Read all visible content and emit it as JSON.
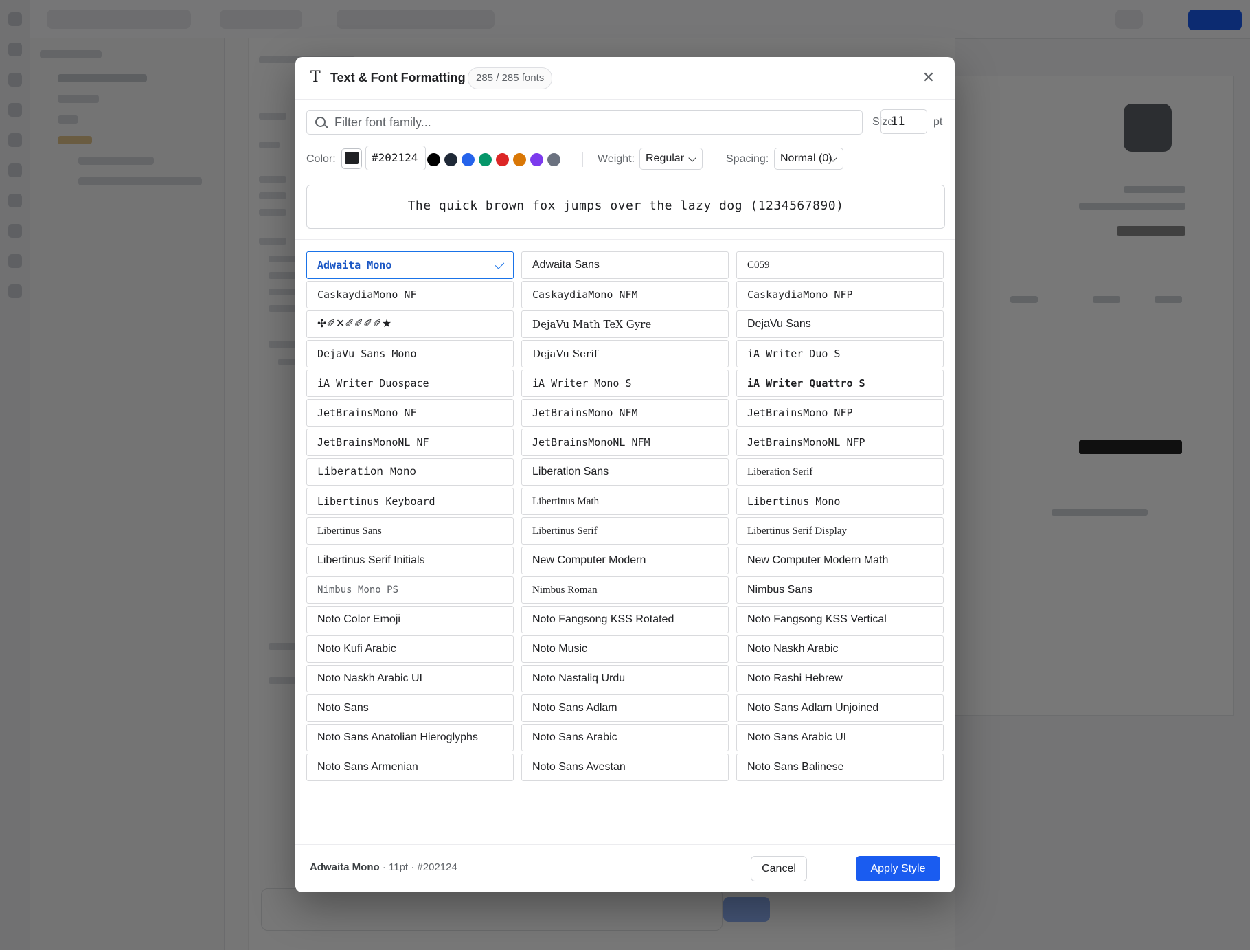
{
  "modal": {
    "title": "Text & Font Formatting",
    "title_icon": "T",
    "font_count": "285 / 285 fonts",
    "close_glyph": "✕",
    "search_placeholder": "Filter font family...",
    "size_label": "Size:",
    "size_value": "11",
    "size_unit": "pt",
    "color_label": "Color:",
    "color_hex": "#202124",
    "preset_colors": [
      "#000000",
      "#1f2937",
      "#2563eb",
      "#059669",
      "#dc2626",
      "#d97706",
      "#7c3aed",
      "#6b7280"
    ],
    "weight_label": "Weight:",
    "weight_value": "Regular",
    "spacing_label": "Spacing:",
    "spacing_value": "Normal (0)",
    "sample_text": "The quick brown fox jumps over the lazy dog (1234567890)",
    "fonts": [
      "Adwaita Mono",
      "Adwaita Sans",
      "C059",
      "CaskaydiaMono NF",
      "CaskaydiaMono NFM",
      "CaskaydiaMono NFP",
      "✣✐✕✐✐✐✐★",
      "DejaVu Math TeX Gyre",
      "DejaVu Sans",
      "DejaVu Sans Mono",
      "DejaVu Serif",
      "iA Writer Duo S",
      "iA Writer Duospace",
      "iA Writer Mono S",
      "iA Writer Quattro S",
      "JetBrainsMono NF",
      "JetBrainsMono NFM",
      "JetBrainsMono NFP",
      "JetBrainsMonoNL NF",
      "JetBrainsMonoNL NFM",
      "JetBrainsMonoNL NFP",
      "Liberation Mono",
      "Liberation Sans",
      "Liberation Serif",
      "Libertinus Keyboard",
      "Libertinus Math",
      "Libertinus Mono",
      "Libertinus Sans",
      "Libertinus Serif",
      "Libertinus Serif Display",
      "Libertinus Serif Initials",
      "New Computer Modern",
      "New Computer Modern Math",
      "Nimbus Mono PS",
      "Nimbus Roman",
      "Nimbus Sans",
      "Noto    Color    Emoji",
      "Noto  Fangsong  KSS  Rotated",
      "Noto  Fangsong  KSS  Vertical",
      "Noto Kufi Arabic",
      "Noto Music",
      "Noto Naskh Arabic",
      "Noto Naskh Arabic UI",
      "Noto Nastaliq Urdu",
      "Noto Rashi Hebrew",
      "Noto Sans",
      "Noto Sans Adlam",
      "Noto Sans Adlam Unjoined",
      "Noto Sans Anatolian Hieroglyphs",
      "Noto Sans Arabic",
      "Noto Sans Arabic UI",
      "Noto Sans Armenian",
      "Noto Sans Avestan",
      "Noto Sans Balinese"
    ],
    "selected_font": "Adwaita Mono",
    "footer_font": "Adwaita Mono",
    "footer_details": " · 11pt · #202124",
    "cancel_label": "Cancel",
    "apply_label": "Apply Style",
    "accent_color": "#1a5cf0"
  }
}
